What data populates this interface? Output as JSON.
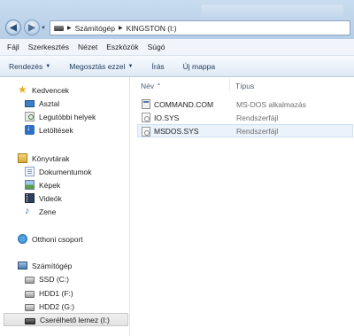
{
  "address": {
    "segments": [
      "Számítógép",
      "KINGSTON (I:)"
    ]
  },
  "menu": [
    "Fájl",
    "Szerkesztés",
    "Nézet",
    "Eszközök",
    "Súgó"
  ],
  "toolbar": {
    "organize": "Rendezés",
    "share": "Megosztás ezzel",
    "burn": "Írás",
    "new_folder": "Új mappa"
  },
  "nav": {
    "favorites": "Kedvencek",
    "desktop": "Asztal",
    "recent": "Legutóbbi helyek",
    "downloads": "Letöltések",
    "libraries": "Könyvtárak",
    "documents": "Dokumentumok",
    "pictures": "Képek",
    "videos": "Videók",
    "music": "Zene",
    "homegroup": "Otthoni csoport",
    "computer": "Számítógép",
    "drive_c": "SSD (C:)",
    "drive_f": "HDD1 (F:)",
    "drive_g": "HDD2 (G:)",
    "drive_i": "Cserélhető lemez (I:)"
  },
  "columns": {
    "name": "Név",
    "type": "Típus"
  },
  "files": [
    {
      "name": "COMMAND.COM",
      "type": "MS-DOS alkalmazás",
      "icon": "com-file-icon"
    },
    {
      "name": "IO.SYS",
      "type": "Rendszerfájl",
      "icon": "sys-file-icon"
    },
    {
      "name": "MSDOS.SYS",
      "type": "Rendszerfájl",
      "icon": "sys-file-icon",
      "selected": true
    }
  ]
}
